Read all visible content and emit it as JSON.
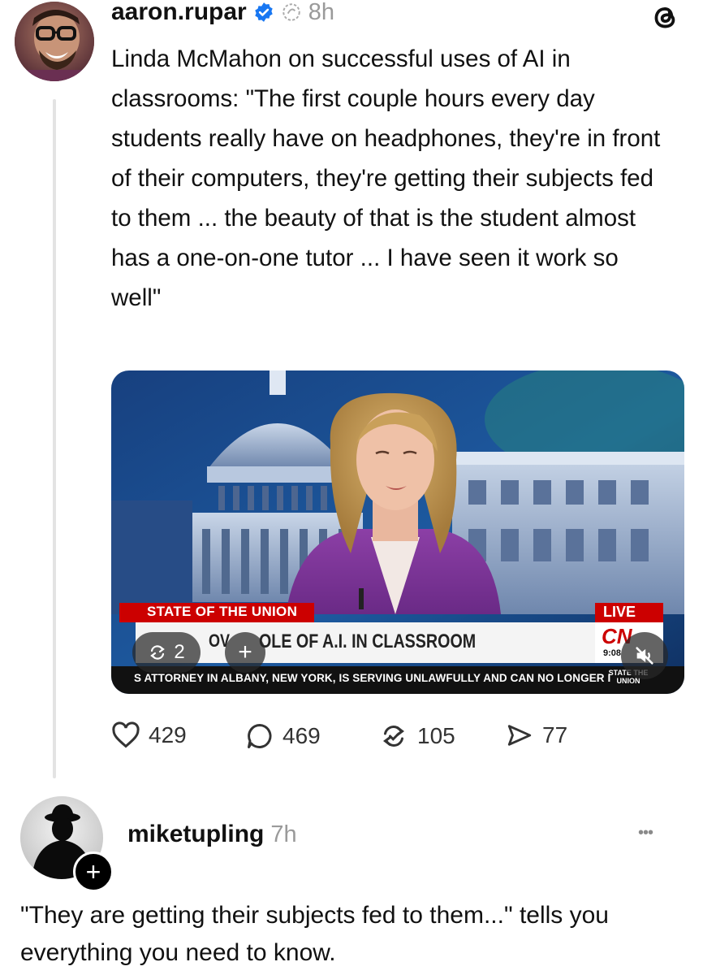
{
  "post": {
    "author": "aaron.rupar",
    "time": "8h",
    "text": "Linda McMahon on successful uses of AI in classrooms: \"The first couple hours every day students really have on headphones, they're in front of their computers, they're getting their subjects fed to them ... the beauty of that is the student almost has a one-on-one tutor ... I have seen it work so well\"",
    "video": {
      "show_banner": "STATE OF THE UNION",
      "live_label": "LIVE",
      "headline": "OLE OF A.I. IN CLASSROOM",
      "headline_fragment": "OV",
      "ticker": "S ATTORNEY IN ALBANY, NEW YORK, IS SERVING UNLAWFULLY AND CAN NO LONGER I",
      "network_logo": "CN",
      "clock": "9:08",
      "bug_text": "STATE THE UNION",
      "repost_count": "2",
      "add_label": "+"
    },
    "actions": {
      "likes": "429",
      "replies": "469",
      "reposts": "105",
      "shares": "77"
    }
  },
  "reply": {
    "author": "miketupling",
    "time": "7h",
    "more": "•••",
    "follow_label": "+",
    "text": "\"They are getting their subjects fed to them...\" tells you everything you need to know."
  },
  "colors": {
    "verified": "#1877f2",
    "text": "#111111",
    "muted": "#9a9a9a",
    "cnn_red": "#cc0000"
  }
}
